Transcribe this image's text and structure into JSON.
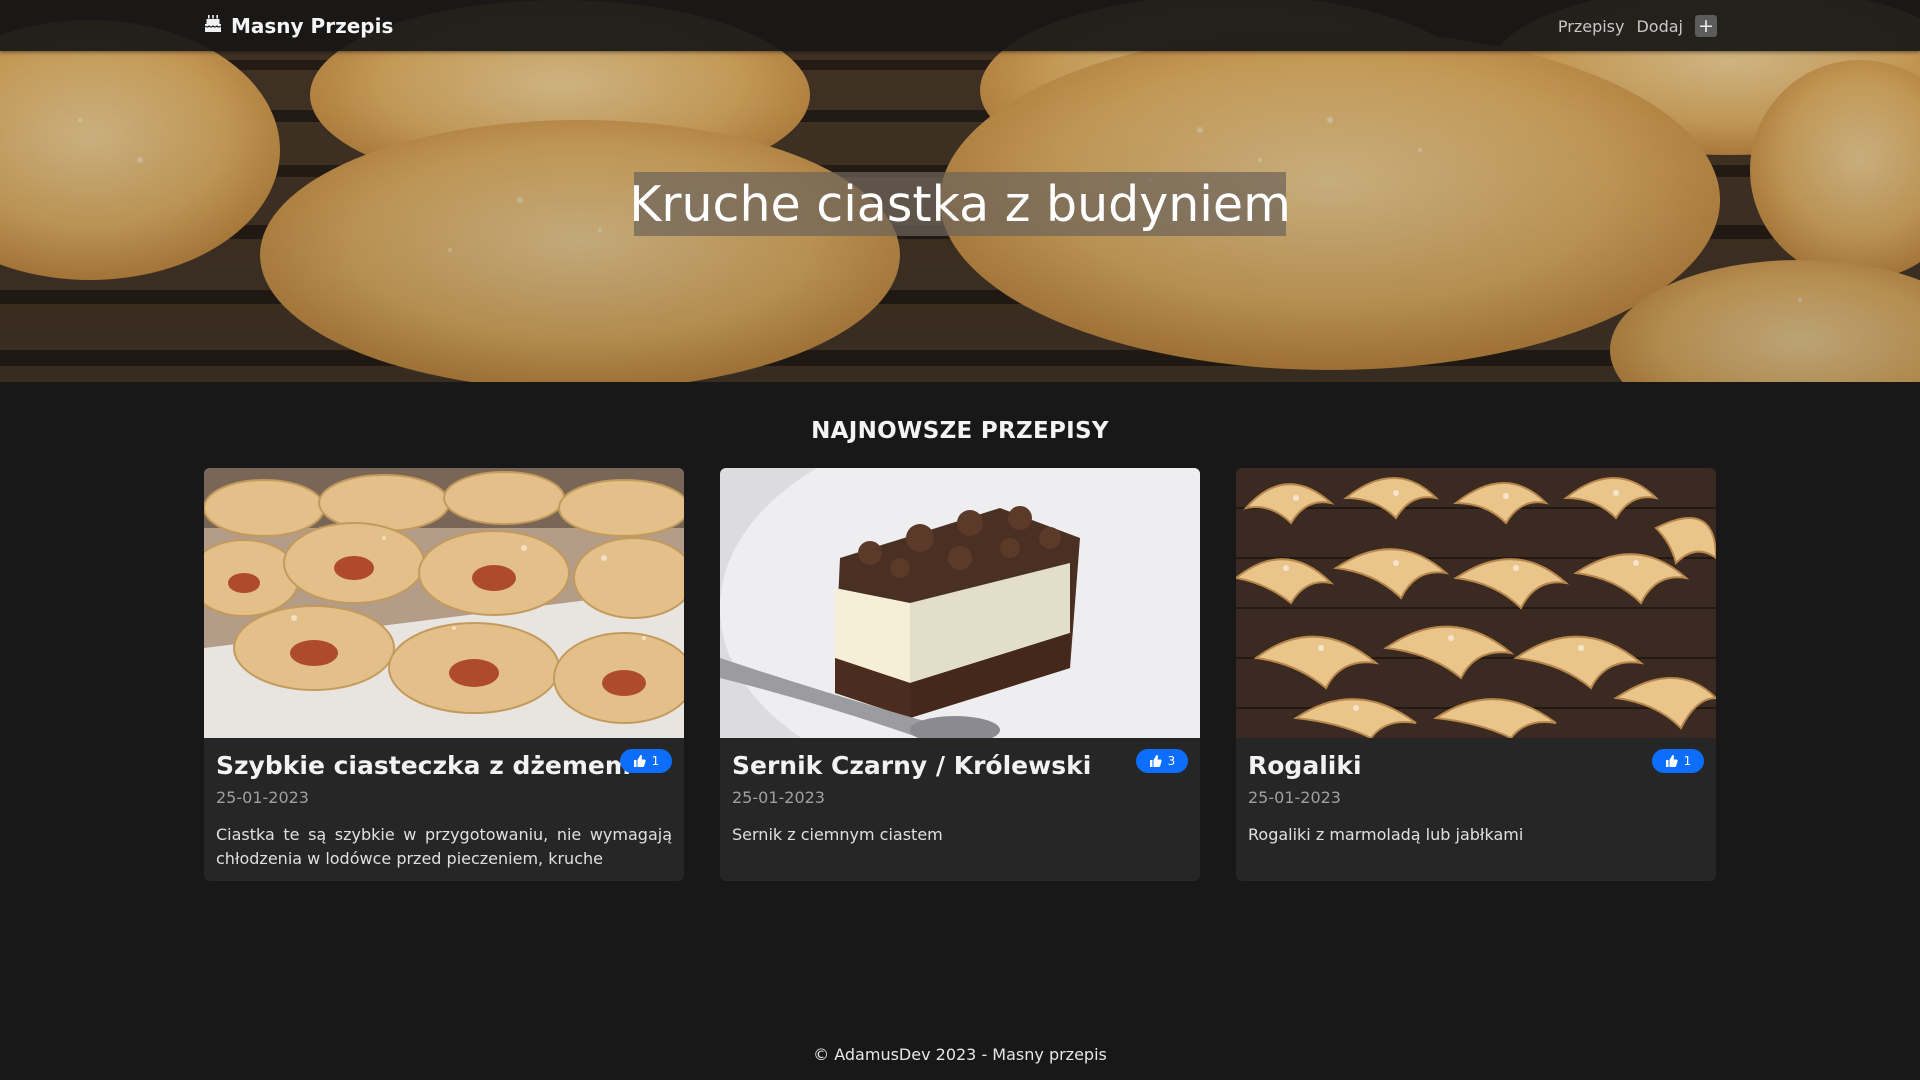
{
  "navbar": {
    "brand": "Masny Przepis",
    "brand_icon": "cake-icon",
    "links": {
      "recipes": "Przepisy",
      "add": "Dodaj"
    },
    "add_icon": "plus-icon"
  },
  "hero": {
    "title": "Kruche ciastka z budyniem"
  },
  "section": {
    "title": "NAJNOWSZE PRZEPISY"
  },
  "cards": [
    {
      "title": "Szybkie ciasteczka z dżemem",
      "date": "25-01-2023",
      "description": "Ciastka te są szybkie w przygotowaniu, nie wymagają chłodzenia w lodówce przed pieczeniem, kruche",
      "likes": "1",
      "image": "jam-rolls-photo"
    },
    {
      "title": "Sernik Czarny / Królewski",
      "date": "25-01-2023",
      "description": "Sernik z ciemnym ciastem",
      "likes": "3",
      "image": "cheesecake-photo"
    },
    {
      "title": "Rogaliki",
      "date": "25-01-2023",
      "description": "Rogaliki z marmoladą lub jabłkami",
      "likes": "1",
      "image": "croissants-photo"
    }
  ],
  "footer": {
    "text": "© AdamusDev 2023 - Masny przepis"
  },
  "colors": {
    "background": "#181818",
    "card": "#262626",
    "badge": "#0d6efd"
  }
}
